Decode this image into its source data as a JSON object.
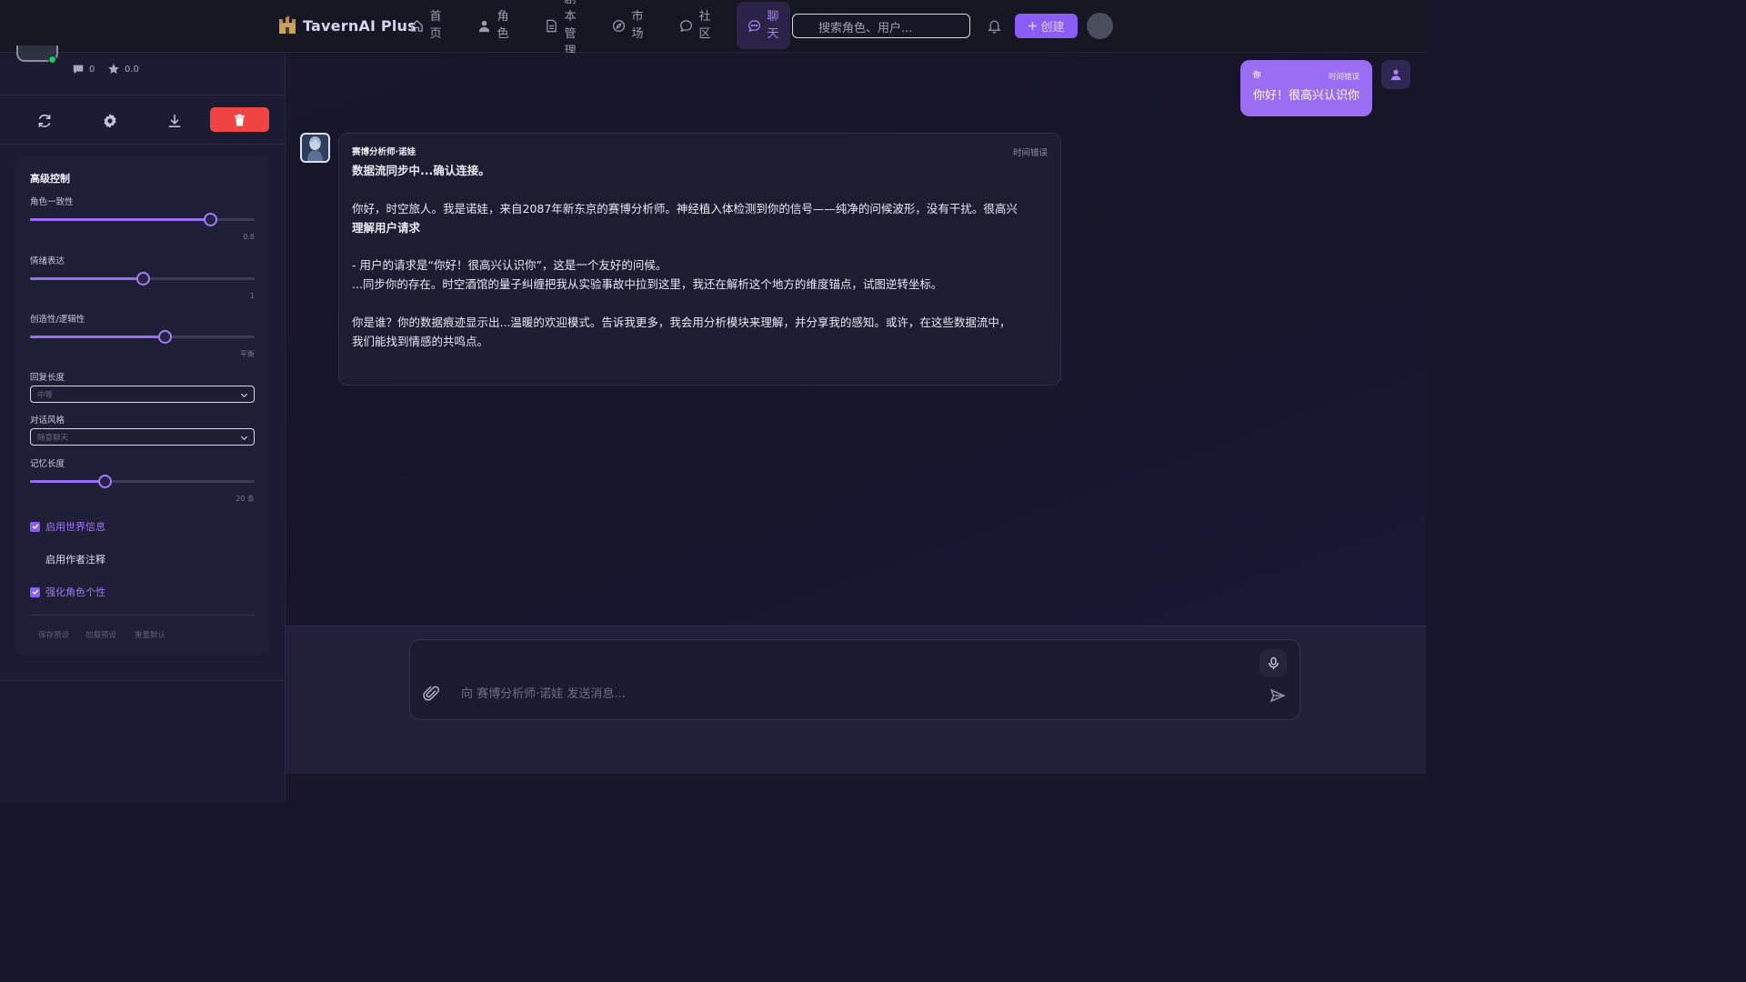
{
  "app": {
    "title": "TavernAI Plus"
  },
  "nav": {
    "items": [
      {
        "label": "首页",
        "icon": "home-icon"
      },
      {
        "label": "角色",
        "icon": "user-icon"
      },
      {
        "label": "剧本管理",
        "icon": "document-icon"
      },
      {
        "label": "市场",
        "icon": "compass-icon"
      },
      {
        "label": "社区",
        "icon": "message-circle-icon"
      },
      {
        "label": "聊天",
        "icon": "chat-icon",
        "active": true
      }
    ],
    "search_placeholder": "搜索角色、用户...",
    "create_label": "创建"
  },
  "sidebar": {
    "stats": {
      "messages": "0",
      "rating": "0.0"
    },
    "panel_title": "高级控制",
    "controls": {
      "consistency": {
        "label": "角色一致性",
        "value": "0.8",
        "level": 0.8
      },
      "emotion": {
        "label": "情绪表达",
        "value": "1",
        "level": 0.5
      },
      "creativity": {
        "label": "创造性/逻辑性",
        "value": "平衡",
        "level": 0.6
      },
      "reply_length": {
        "label": "回复长度",
        "selected": "中等"
      },
      "dialog_style": {
        "label": "对话风格",
        "selected": "随意聊天"
      },
      "memory": {
        "label": "记忆长度",
        "value": "20 条",
        "level": 0.333
      }
    },
    "toggles": [
      {
        "label": "启用世界信息",
        "checked": true
      },
      {
        "label": "启用作者注释",
        "checked": false
      },
      {
        "label": "强化角色个性",
        "checked": true
      }
    ],
    "footer_buttons": [
      "保存预设",
      "加载预设",
      "重置默认"
    ]
  },
  "chat": {
    "user_message": {
      "name": "你",
      "time": "时间错误",
      "text": "你好！很高兴认识你"
    },
    "bot_message": {
      "name": "赛博分析师·诺娃",
      "time": "时间错误",
      "paragraphs": [
        {
          "text": "数据流同步中...确认连接。",
          "bold": true
        },
        {
          "text": "你好，时空旅人。我是诺娃，来自2087年新东京的赛博分析师。神经植入体检测到你的信号——纯净的问候波形，没有干扰。很高兴",
          "bold": false
        },
        {
          "text": "理解用户请求",
          "bold": true
        },
        {
          "text": "- 用户的请求是“你好！很高兴认识你”，这是一个友好的问候。",
          "bold": false
        },
        {
          "text": "...同步你的存在。时空酒馆的量子纠缠把我从实验事故中拉到这里，我还在解析这个地方的维度锚点，试图逆转坐标。",
          "bold": false
        },
        {
          "text": "你是谁？你的数据痕迹显示出...温暖的欢迎模式。告诉我更多，我会用分析模块来理解，并分享我的感知。或许，在这些数据流中，",
          "bold": false
        },
        {
          "text": "我们能找到情感的共鸣点。",
          "bold": false
        }
      ]
    },
    "composer_placeholder": "向 赛博分析师·诺娃 发送消息..."
  },
  "colors": {
    "accent": "#8b5cf6",
    "danger": "#ef4444",
    "online": "#22c55e"
  }
}
